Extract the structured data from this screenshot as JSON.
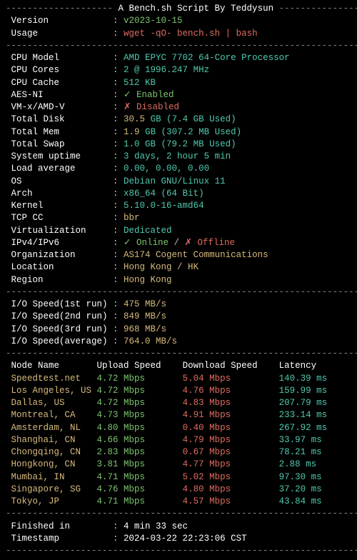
{
  "header": {
    "title_line": "A Bench.sh Script By Teddysun"
  },
  "meta": {
    "version_label": " Version",
    "version_value": "v2023-10-15",
    "usage_label": " Usage",
    "usage_value": "wget -qO- bench.sh | bash"
  },
  "sys": [
    {
      "label": " CPU Model",
      "value": "AMD EPYC 7702 64-Core Processor",
      "cls": "cyan"
    },
    {
      "label": " CPU Cores",
      "value": "2 @ 1996.247 MHz",
      "cls": "cyan"
    },
    {
      "label": " CPU Cache",
      "value": "512 KB",
      "cls": "cyan"
    },
    {
      "label": " AES-NI",
      "parts": [
        {
          "t": "✓ Enabled",
          "c": "green"
        }
      ]
    },
    {
      "label": " VM-x/AMD-V",
      "parts": [
        {
          "t": "✗ Disabled",
          "c": "red"
        }
      ]
    },
    {
      "label": " Total Disk",
      "parts": [
        {
          "t": "30.5 ",
          "c": "yellow"
        },
        {
          "t": "GB ",
          "c": "cyan"
        },
        {
          "t": "(7.4 GB Used)",
          "c": "cyan"
        }
      ]
    },
    {
      "label": " Total Mem",
      "parts": [
        {
          "t": "1.9 ",
          "c": "yellow"
        },
        {
          "t": "GB ",
          "c": "cyan"
        },
        {
          "t": "(307.2 MB Used)",
          "c": "cyan"
        }
      ]
    },
    {
      "label": " Total Swap",
      "parts": [
        {
          "t": "1.0 GB (79.2 MB Used)",
          "c": "cyan"
        }
      ]
    },
    {
      "label": " System uptime",
      "value": "3 days, 2 hour 5 min",
      "cls": "cyan"
    },
    {
      "label": " Load average",
      "value": "0.00, 0.00, 0.00",
      "cls": "cyan"
    },
    {
      "label": " OS",
      "value": "Debian GNU/Linux 11",
      "cls": "cyan"
    },
    {
      "label": " Arch",
      "value": "x86_64 (64 Bit)",
      "cls": "cyan"
    },
    {
      "label": " Kernel",
      "value": "5.10.0-16-amd64",
      "cls": "cyan"
    },
    {
      "label": " TCP CC",
      "value": "bbr",
      "cls": "yellow"
    },
    {
      "label": " Virtualization",
      "value": "Dedicated",
      "cls": "cyan"
    },
    {
      "label": " IPv4/IPv6",
      "parts": [
        {
          "t": "✓ Online",
          "c": "green"
        },
        {
          "t": " / ",
          "c": "gray"
        },
        {
          "t": "✗ Offline",
          "c": "red"
        }
      ]
    },
    {
      "label": " Organization",
      "value": "AS174 Cogent Communications",
      "cls": "yellow"
    },
    {
      "label": " Location",
      "value": "Hong Kong / HK",
      "cls": "yellow"
    },
    {
      "label": " Region",
      "value": "Hong Kong",
      "cls": "yellow"
    }
  ],
  "io": [
    {
      "label": " I/O Speed(1st run)",
      "value": "475 MB/s"
    },
    {
      "label": " I/O Speed(2nd run)",
      "value": "849 MB/s"
    },
    {
      "label": " I/O Speed(3rd run)",
      "value": "968 MB/s"
    },
    {
      "label": " I/O Speed(average)",
      "value": "764.0 MB/s"
    }
  ],
  "speedtest": {
    "headers": {
      "node": " Node Name",
      "up": "Upload Speed",
      "down": "Download Speed",
      "lat": "Latency"
    },
    "rows": [
      {
        "node": " Speedtest.net",
        "up": "4.72 Mbps",
        "down": "5.04 Mbps",
        "lat": "140.39 ms"
      },
      {
        "node": " Los Angeles, US",
        "up": "4.72 Mbps",
        "down": "4.76 Mbps",
        "lat": "159.99 ms"
      },
      {
        "node": " Dallas, US",
        "up": "4.72 Mbps",
        "down": "4.83 Mbps",
        "lat": "207.79 ms"
      },
      {
        "node": " Montreal, CA",
        "up": "4.73 Mbps",
        "down": "4.91 Mbps",
        "lat": "233.14 ms"
      },
      {
        "node": " Amsterdam, NL",
        "up": "4.80 Mbps",
        "down": "0.40 Mbps",
        "lat": "267.92 ms"
      },
      {
        "node": " Shanghai, CN",
        "up": "4.66 Mbps",
        "down": "4.79 Mbps",
        "lat": "33.97 ms"
      },
      {
        "node": " Chongqing, CN",
        "up": "2.83 Mbps",
        "down": "0.67 Mbps",
        "lat": "78.21 ms"
      },
      {
        "node": " Hongkong, CN",
        "up": "3.81 Mbps",
        "down": "4.77 Mbps",
        "lat": "2.88 ms"
      },
      {
        "node": " Mumbai, IN",
        "up": "4.71 Mbps",
        "down": "5.02 Mbps",
        "lat": "97.30 ms"
      },
      {
        "node": " Singapore, SG",
        "up": "4.76 Mbps",
        "down": "4.80 Mbps",
        "lat": "37.20 ms"
      },
      {
        "node": " Tokyo, JP",
        "up": "4.71 Mbps",
        "down": "4.57 Mbps",
        "lat": "43.84 ms"
      }
    ]
  },
  "footer": {
    "finished_label": " Finished in",
    "finished_value": "4 min 33 sec",
    "timestamp_label": " Timestamp",
    "timestamp_value": "2024-03-22 22:23:06 CST"
  },
  "chart_data": {
    "type": "table",
    "title": "Bench.sh speedtest results",
    "columns": [
      "Node Name",
      "Upload Speed (Mbps)",
      "Download Speed (Mbps)",
      "Latency (ms)"
    ],
    "rows": [
      [
        "Speedtest.net",
        4.72,
        5.04,
        140.39
      ],
      [
        "Los Angeles, US",
        4.72,
        4.76,
        159.99
      ],
      [
        "Dallas, US",
        4.72,
        4.83,
        207.79
      ],
      [
        "Montreal, CA",
        4.73,
        4.91,
        233.14
      ],
      [
        "Amsterdam, NL",
        4.8,
        0.4,
        267.92
      ],
      [
        "Shanghai, CN",
        4.66,
        4.79,
        33.97
      ],
      [
        "Chongqing, CN",
        2.83,
        0.67,
        78.21
      ],
      [
        "Hongkong, CN",
        3.81,
        4.77,
        2.88
      ],
      [
        "Mumbai, IN",
        4.71,
        5.02,
        97.3
      ],
      [
        "Singapore, SG",
        4.76,
        4.8,
        37.2
      ],
      [
        "Tokyo, JP",
        4.71,
        4.57,
        43.84
      ]
    ]
  }
}
